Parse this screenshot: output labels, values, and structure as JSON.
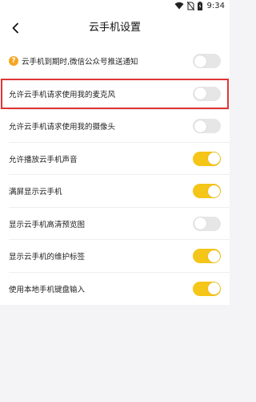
{
  "status_bar": {
    "time": "9:34"
  },
  "nav": {
    "title": "云手机设置"
  },
  "colors": {
    "toggle_on": "#f5c518",
    "toggle_off": "#e6e6e6",
    "highlight": "#e23434",
    "help_icon": "#f5a623"
  },
  "settings": [
    {
      "label": "云手机到期时,微信公众号推送通知",
      "on": false,
      "help_icon": "question-circle-icon"
    },
    {
      "label": "允许云手机请求使用我的麦克风",
      "on": false,
      "highlighted": true
    },
    {
      "label": "允许云手机请求使用我的摄像头",
      "on": false
    },
    {
      "label": "允许播放云手机声音",
      "on": true
    },
    {
      "label": "满屏显示云手机",
      "on": true
    },
    {
      "label": "显示云手机高清预览图",
      "on": false
    },
    {
      "label": "显示云手机的维护标签",
      "on": true
    },
    {
      "label": "使用本地手机键盘输入",
      "on": true
    }
  ]
}
